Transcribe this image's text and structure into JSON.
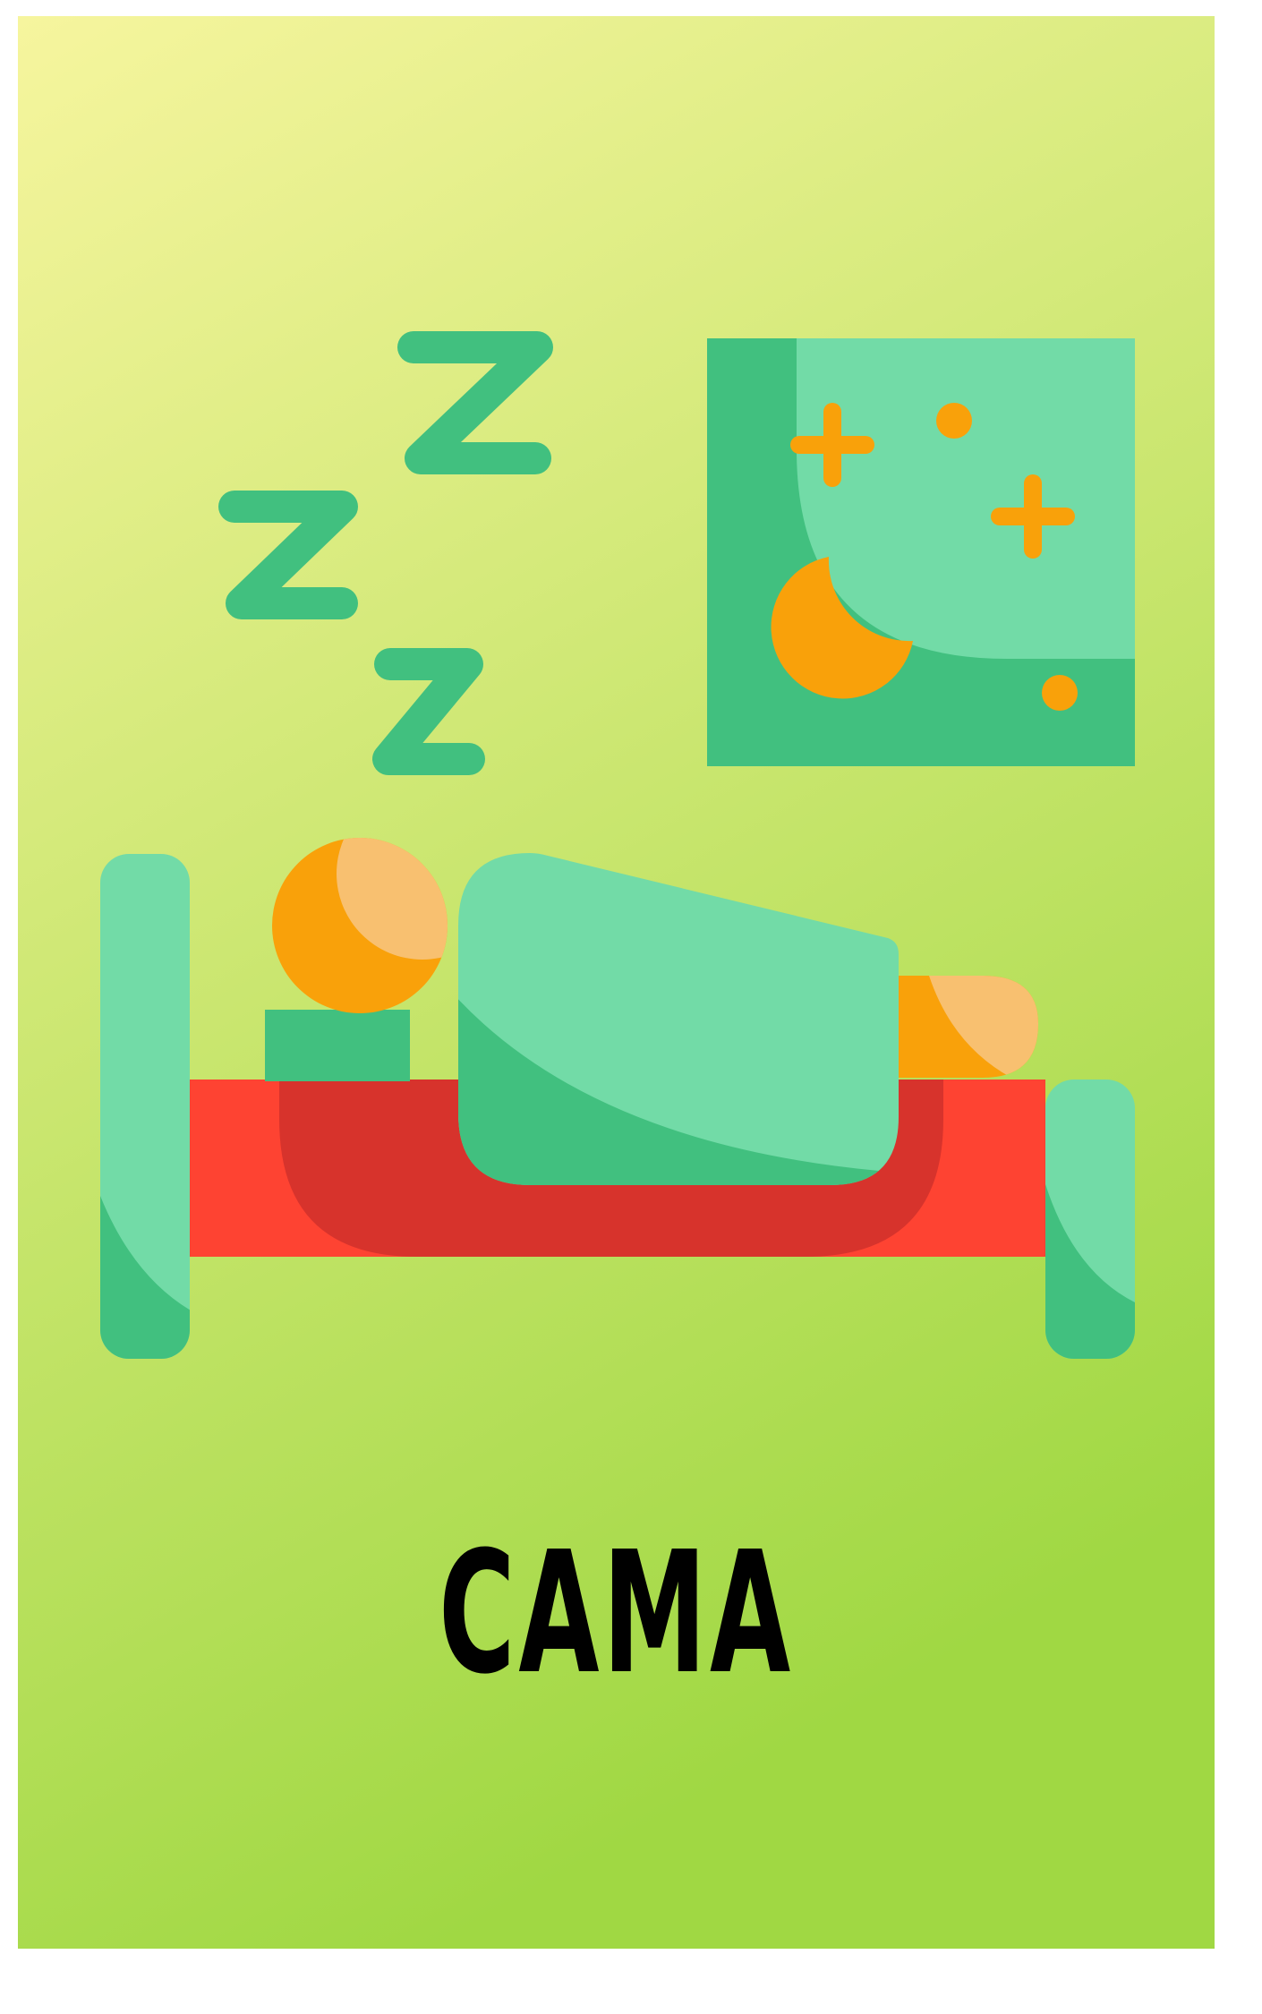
{
  "card": {
    "label": "CAMA"
  },
  "illustration": {
    "subject": "person-sleeping-in-bed-icon",
    "icons": [
      "sleep-z-icon",
      "night-window-icon",
      "moon-icon",
      "star-icon",
      "bed-icon",
      "sleeper-head-icon",
      "blanket-icon",
      "pillow-icon"
    ]
  },
  "colors": {
    "gradient_top": "#f6f59e",
    "gradient_bottom": "#a0d843",
    "green_light": "#72dba7",
    "green_dark": "#41c07f",
    "orange": "#f9a10a",
    "skin": "#f8c070",
    "red": "#fe4332",
    "red_dark": "#d7332c"
  }
}
